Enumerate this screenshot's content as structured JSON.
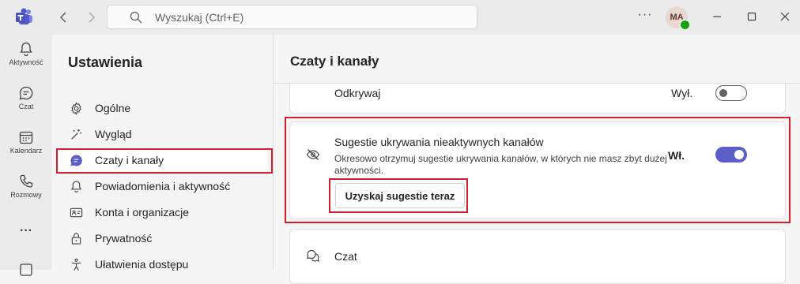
{
  "search": {
    "placeholder": "Wyszukaj (Ctrl+E)"
  },
  "user": {
    "initials": "MA"
  },
  "rail": [
    {
      "label": "Aktywność",
      "icon": "bell-icon"
    },
    {
      "label": "Czat",
      "icon": "chat-icon"
    },
    {
      "label": "Kalendarz",
      "icon": "calendar-icon"
    },
    {
      "label": "Rozmowy",
      "icon": "phone-icon"
    }
  ],
  "settings": {
    "title": "Ustawienia",
    "items": [
      {
        "label": "Ogólne",
        "icon": "gear-icon"
      },
      {
        "label": "Wygląd",
        "icon": "magic-wand-icon"
      },
      {
        "label": "Czaty i kanały",
        "icon": "chat-bubble-icon",
        "active": true
      },
      {
        "label": "Powiadomienia i aktywność",
        "icon": "bell-icon"
      },
      {
        "label": "Konta i organizacje",
        "icon": "id-card-icon"
      },
      {
        "label": "Prywatność",
        "icon": "lock-icon"
      },
      {
        "label": "Ułatwienia dostępu",
        "icon": "accessibility-icon"
      }
    ]
  },
  "content": {
    "title": "Czaty i kanały",
    "top_card": {
      "label": "Odkrywaj",
      "state": "Wył."
    },
    "suggest_card": {
      "title": "Sugestie ukrywania nieaktywnych kanałów",
      "description": "Okresowo otrzymuj sugestie ukrywania kanałów, w których nie masz zbyt dużej aktywności.",
      "state": "Wł.",
      "button": "Uzyskaj sugestie teraz"
    },
    "chat_card": {
      "label": "Czat"
    }
  },
  "colors": {
    "accent": "#5b5fc7",
    "highlight": "#d21f2b",
    "presence": "#13a10e"
  }
}
